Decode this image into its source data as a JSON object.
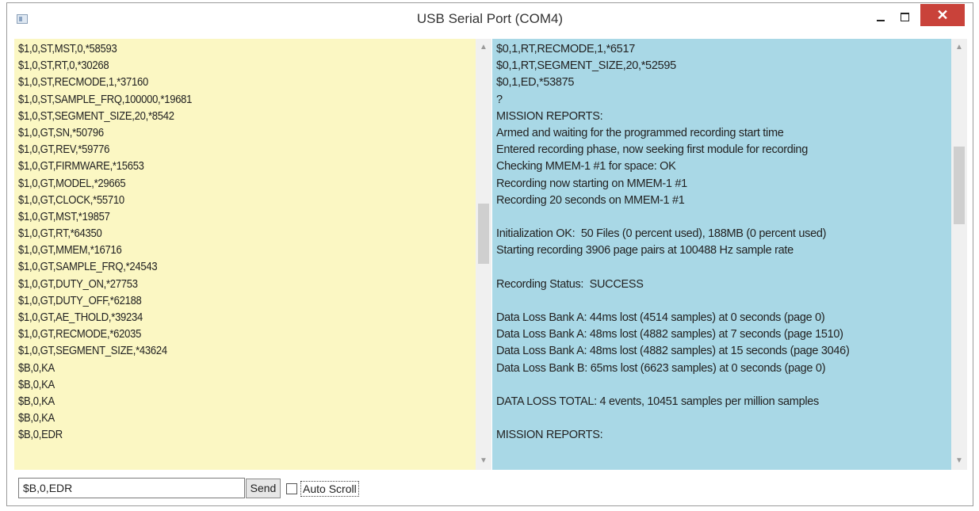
{
  "window": {
    "title": "USB Serial Port (COM4)",
    "close_symbol": "✕",
    "icons": {
      "app": "app-icon",
      "minimize": "minimize-icon",
      "maximize": "maximize-icon",
      "close": "close-icon"
    },
    "colors": {
      "close": "#c9423a",
      "left_pane": "#fbf7c3",
      "right_pane": "#a9d8e6"
    }
  },
  "left_pane": {
    "lines": [
      "$1,0,ST,MST,0,*58593",
      "$1,0,ST,RT,0,*30268",
      "$1,0,ST,RECMODE,1,*37160",
      "$1,0,ST,SAMPLE_FRQ,100000,*19681",
      "$1,0,ST,SEGMENT_SIZE,20,*8542",
      "$1,0,GT,SN,*50796",
      "$1,0,GT,REV,*59776",
      "$1,0,GT,FIRMWARE,*15653",
      "$1,0,GT,MODEL,*29665",
      "$1,0,GT,CLOCK,*55710",
      "$1,0,GT,MST,*19857",
      "$1,0,GT,RT,*64350",
      "$1,0,GT,MMEM,*16716",
      "$1,0,GT,SAMPLE_FRQ,*24543",
      "$1,0,GT,DUTY_ON,*27753",
      "$1,0,GT,DUTY_OFF,*62188",
      "$1,0,GT,AE_THOLD,*39234",
      "$1,0,GT,RECMODE,*62035",
      "$1,0,GT,SEGMENT_SIZE,*43624",
      "$B,0,KA",
      "$B,0,KA",
      "$B,0,KA",
      "$B,0,KA",
      "$B,0,EDR"
    ]
  },
  "right_pane": {
    "lines": [
      "$0,1,RT,RECMODE,1,*6517",
      "$0,1,RT,SEGMENT_SIZE,20,*52595",
      "$0,1,ED,*53875",
      "?",
      "MISSION REPORTS:",
      "Armed and waiting for the programmed recording start time",
      "Entered recording phase, now seeking first module for recording",
      "Checking MMEM-1 #1 for space: OK",
      "Recording now starting on MMEM-1 #1",
      "Recording 20 seconds on MMEM-1 #1",
      "",
      "Initialization OK:  50 Files (0 percent used), 188MB (0 percent used)",
      "Starting recording 3906 page pairs at 100488 Hz sample rate",
      "",
      "Recording Status:  SUCCESS",
      "",
      "Data Loss Bank A: 44ms lost (4514 samples) at 0 seconds (page 0)",
      "Data Loss Bank A: 48ms lost (4882 samples) at 7 seconds (page 1510)",
      "Data Loss Bank A: 48ms lost (4882 samples) at 15 seconds (page 3046)",
      "Data Loss Bank B: 65ms lost (6623 samples) at 0 seconds (page 0)",
      "",
      "DATA LOSS TOTAL: 4 events, 10451 samples per million samples",
      "",
      "MISSION REPORTS:"
    ]
  },
  "footer": {
    "command_value": "$B,0,EDR",
    "send_label": "Send",
    "autoscroll_label": "Auto Scroll",
    "autoscroll_checked": false
  }
}
